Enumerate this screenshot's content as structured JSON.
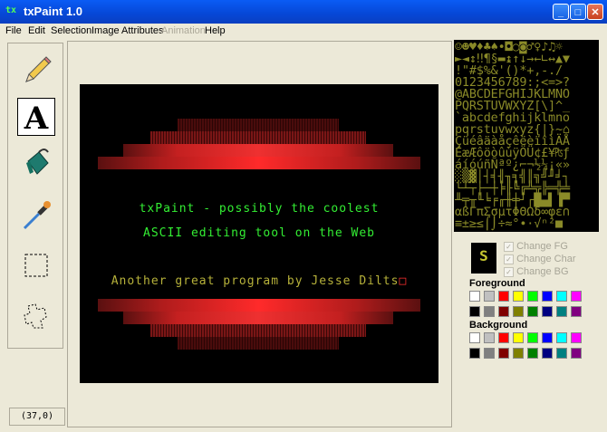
{
  "window": {
    "title": "txPaint 1.0",
    "app_icon_text": "tx",
    "minimize": "_",
    "maximize": "□",
    "close": "✕"
  },
  "menu": [
    {
      "label": "File",
      "enabled": true
    },
    {
      "label": "Edit",
      "enabled": true
    },
    {
      "label": "Selection",
      "enabled": true
    },
    {
      "label": "Image Attributes",
      "enabled": true
    },
    {
      "label": "Animation",
      "enabled": false
    },
    {
      "label": "Help",
      "enabled": true
    }
  ],
  "tools": [
    {
      "name": "pencil-icon",
      "selected": false
    },
    {
      "name": "text-icon",
      "selected": true,
      "glyph": "A"
    },
    {
      "name": "paint-bucket-icon",
      "selected": false
    },
    {
      "name": "eyedropper-icon",
      "selected": false
    },
    {
      "name": "rect-select-icon",
      "selected": false
    },
    {
      "name": "lasso-icon",
      "selected": false
    }
  ],
  "status": {
    "coords": "(37,0)"
  },
  "canvas": {
    "line1": "txPaint - possibly the coolest",
    "line2": "ASCII editing tool on the Web",
    "line3": "Another great program by Jesse Dilts",
    "cursor": "□",
    "green": "#33ee33",
    "olive": "#b6b13a"
  },
  "charset_rows": [
    "☺☻♥♦♣♠•◘○◙♂♀♪♫☼",
    "►◄↕‼¶§▬↨↑↓→←∟↔▲▼",
    " !\"#$%&'()*+,-./",
    "0123456789:;<=>?",
    "@ABCDEFGHIJKLMNO",
    "PQRSTUVWXYZ[\\]^_",
    "`abcdefghijklmno",
    "pqrstuvwxyz{|}~⌂",
    "ÇüéâäàåçêëèïîìÄÅ",
    "ÉæÆôöòûùÿÖÜ¢£¥₧ƒ",
    "áíóúñÑªº¿⌐¬½¼¡«»",
    "░▒▓│┤╡╢╖╕╣║╗╝╜╛┐",
    "└┴┬├─┼╞╟╚╔╩╦╠═╬╧",
    "╨╤╥╙╘╒╓╫╪┘┌█▄▌▐▀",
    "αßΓπΣσµτΦΘΩδ∞φε∩",
    "≡±≥≤⌠⌡÷≈°∙·√ⁿ²■ "
  ],
  "preview_char": "S",
  "checkboxes": [
    {
      "label": "Change FG",
      "checked": true
    },
    {
      "label": "Change Char",
      "checked": true
    },
    {
      "label": "Change BG",
      "checked": true
    }
  ],
  "foreground": {
    "label": "Foreground",
    "colors": [
      "#ffffff",
      "#c0c0c0",
      "#ff0000",
      "#ffff00",
      "#00ff00",
      "#0000ff",
      "#00ffff",
      "#ff00ff",
      "#000000",
      "#808080",
      "#800000",
      "#808000",
      "#008000",
      "#000080",
      "#008080",
      "#800080"
    ]
  },
  "background": {
    "label": "Background",
    "colors": [
      "#ffffff",
      "#c0c0c0",
      "#ff0000",
      "#ffff00",
      "#00ff00",
      "#0000ff",
      "#00ffff",
      "#ff00ff",
      "#000000",
      "#808080",
      "#800000",
      "#808000",
      "#008000",
      "#000080",
      "#008080",
      "#800080"
    ]
  }
}
